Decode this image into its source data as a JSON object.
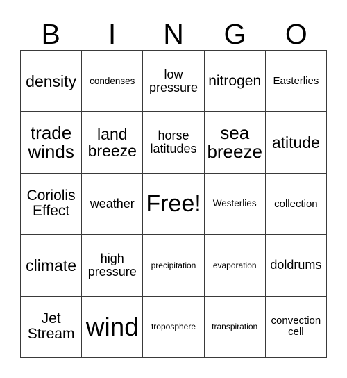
{
  "card": {
    "title": "BINGO",
    "header_letters": [
      "B",
      "I",
      "N",
      "G",
      "O"
    ],
    "grid_size": "5x5",
    "colors": {
      "background": "#ffffff",
      "grid_line": "#3a3a3a",
      "text": "#000000"
    },
    "free_space": "Free!",
    "rows": [
      [
        {
          "label": "density",
          "size": "xl"
        },
        {
          "label": "condenses",
          "size": "s"
        },
        {
          "label": "low pressure",
          "size": "ml"
        },
        {
          "label": "nitrogen",
          "size": "l"
        },
        {
          "label": "Easterlies",
          "size": "m"
        }
      ],
      [
        {
          "label": "trade winds",
          "size": "xxl"
        },
        {
          "label": "land breeze",
          "size": "xl"
        },
        {
          "label": "horse latitudes",
          "size": "ml"
        },
        {
          "label": "sea breeze",
          "size": "xxl"
        },
        {
          "label": "atitude",
          "size": "xl"
        }
      ],
      [
        {
          "label": "Coriolis Effect",
          "size": "l"
        },
        {
          "label": "weather",
          "size": "ml"
        },
        {
          "label": "Free!",
          "size": "3xl"
        },
        {
          "label": "Westerlies",
          "size": "s"
        },
        {
          "label": "collection",
          "size": "m"
        }
      ],
      [
        {
          "label": "climate",
          "size": "xl"
        },
        {
          "label": "high pressure",
          "size": "ml"
        },
        {
          "label": "precipitation",
          "size": "xs"
        },
        {
          "label": "evaporation",
          "size": "xs"
        },
        {
          "label": "doldrums",
          "size": "ml"
        }
      ],
      [
        {
          "label": "Jet Stream",
          "size": "l"
        },
        {
          "label": "wind",
          "size": "4xl"
        },
        {
          "label": "troposphere",
          "size": "xs"
        },
        {
          "label": "transpiration",
          "size": "xs"
        },
        {
          "label": "convection cell",
          "size": "m"
        }
      ]
    ]
  }
}
